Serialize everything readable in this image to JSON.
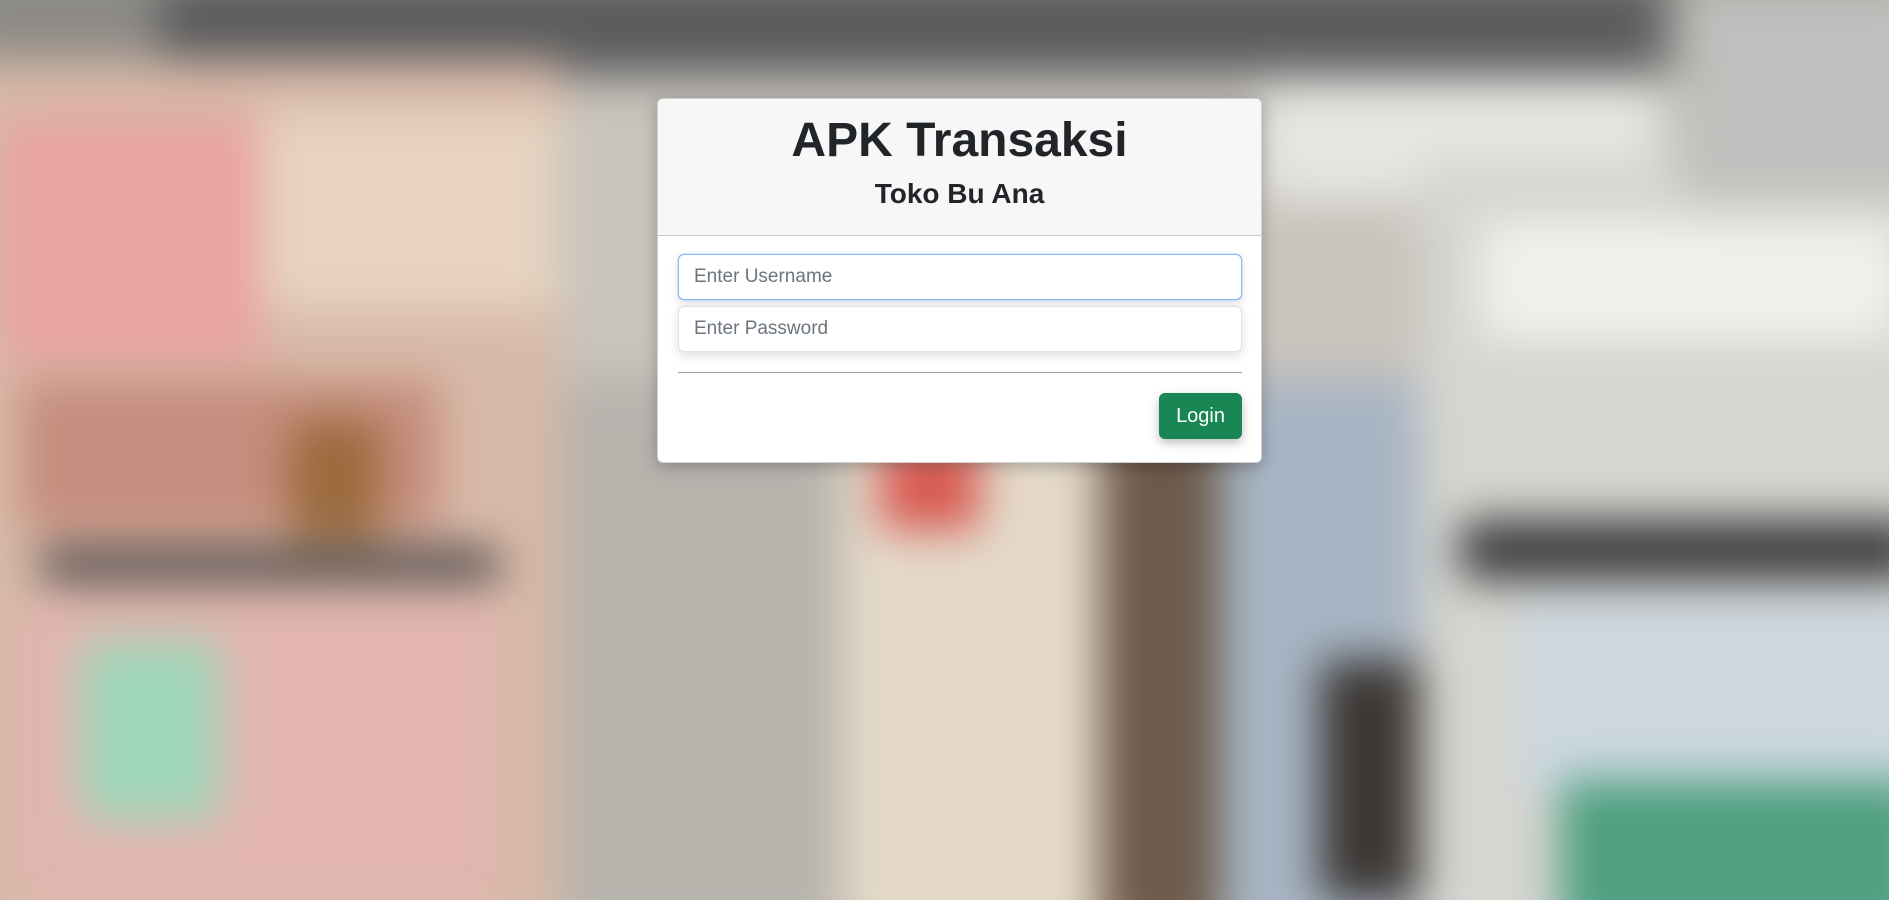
{
  "app": {
    "title": "APK Transaksi",
    "subtitle": "Toko Bu Ana"
  },
  "form": {
    "username_placeholder": "Enter Username",
    "username_value": "",
    "password_placeholder": "Enter Password",
    "password_value": "",
    "login_label": "Login"
  },
  "colors": {
    "login_button": "#198754",
    "header_bg": "#f7f7f7",
    "focus_border": "#86b7fe"
  }
}
